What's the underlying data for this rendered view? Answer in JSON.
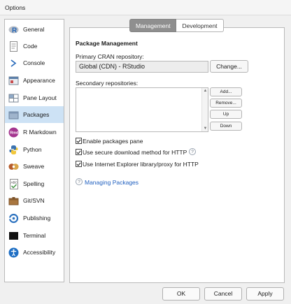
{
  "window": {
    "title": "Options"
  },
  "sidebar": {
    "items": [
      {
        "label": "General",
        "icon": "r-logo-icon",
        "selected": false
      },
      {
        "label": "Code",
        "icon": "code-page-icon",
        "selected": false
      },
      {
        "label": "Console",
        "icon": "console-prompt-icon",
        "selected": false
      },
      {
        "label": "Appearance",
        "icon": "appearance-icon",
        "selected": false
      },
      {
        "label": "Pane Layout",
        "icon": "pane-layout-icon",
        "selected": false
      },
      {
        "label": "Packages",
        "icon": "packages-icon",
        "selected": true
      },
      {
        "label": "R Markdown",
        "icon": "rmarkdown-icon",
        "selected": false
      },
      {
        "label": "Python",
        "icon": "python-icon",
        "selected": false
      },
      {
        "label": "Sweave",
        "icon": "sweave-icon",
        "selected": false
      },
      {
        "label": "Spelling",
        "icon": "spelling-icon",
        "selected": false
      },
      {
        "label": "Git/SVN",
        "icon": "git-svn-icon",
        "selected": false
      },
      {
        "label": "Publishing",
        "icon": "publishing-icon",
        "selected": false
      },
      {
        "label": "Terminal",
        "icon": "terminal-icon",
        "selected": false
      },
      {
        "label": "Accessibility",
        "icon": "accessibility-icon",
        "selected": false
      }
    ],
    "rmarkdown_icon_text": "Rmd"
  },
  "tabs": [
    {
      "label": "Management",
      "active": true
    },
    {
      "label": "Development",
      "active": false
    }
  ],
  "management": {
    "section_title": "Package Management",
    "primary_label": "Primary CRAN repository:",
    "primary_value": "Global (CDN) - RStudio",
    "change_button": "Change...",
    "secondary_label": "Secondary repositories:",
    "secondary_buttons": [
      "Add...",
      "Remove...",
      "Up",
      "Down"
    ],
    "checkboxes": [
      {
        "label": "Enable packages pane",
        "checked": true,
        "help": false
      },
      {
        "label": "Use secure download method for HTTP",
        "checked": true,
        "help": true
      },
      {
        "label": "Use Internet Explorer library/proxy for HTTP",
        "checked": true,
        "help": false
      }
    ],
    "help_link": "Managing Packages",
    "help_icon_text": "?"
  },
  "footer": {
    "ok": "OK",
    "cancel": "Cancel",
    "apply": "Apply"
  },
  "colors": {
    "selected_item": "#cde2f5",
    "active_tab": "#8f8f8f",
    "link": "#1f5fbf"
  }
}
